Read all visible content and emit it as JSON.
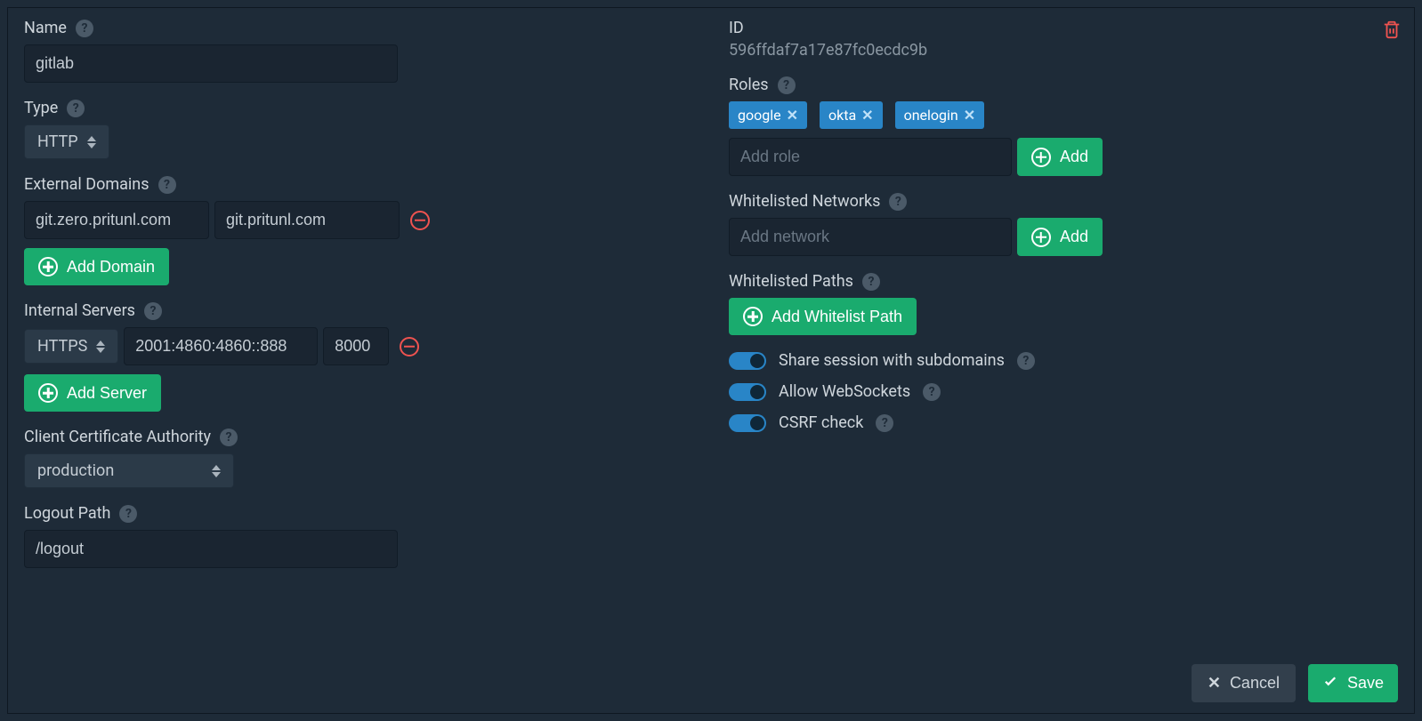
{
  "left": {
    "name_label": "Name",
    "name_value": "gitlab",
    "type_label": "Type",
    "type_value": "HTTP",
    "external_domains_label": "External Domains",
    "external_domain_1": "git.zero.pritunl.com",
    "external_domain_2": "git.pritunl.com",
    "add_domain_btn": "Add Domain",
    "internal_servers_label": "Internal Servers",
    "server_proto": "HTTPS",
    "server_host": "2001:4860:4860::888",
    "server_port": "8000",
    "add_server_btn": "Add Server",
    "cca_label": "Client Certificate Authority",
    "cca_value": "production",
    "logout_path_label": "Logout Path",
    "logout_path_value": "/logout"
  },
  "right": {
    "id_label": "ID",
    "id_value": "596ffdaf7a17e87fc0ecdc9b",
    "roles_label": "Roles",
    "roles": [
      "google",
      "okta",
      "onelogin"
    ],
    "add_role_placeholder": "Add role",
    "add_btn": "Add",
    "wl_networks_label": "Whitelisted Networks",
    "add_network_placeholder": "Add network",
    "wl_paths_label": "Whitelisted Paths",
    "add_wl_path_btn": "Add Whitelist Path",
    "switch_share": "Share session with subdomains",
    "switch_ws": "Allow WebSockets",
    "switch_csrf": "CSRF check"
  },
  "footer": {
    "cancel": "Cancel",
    "save": "Save"
  }
}
